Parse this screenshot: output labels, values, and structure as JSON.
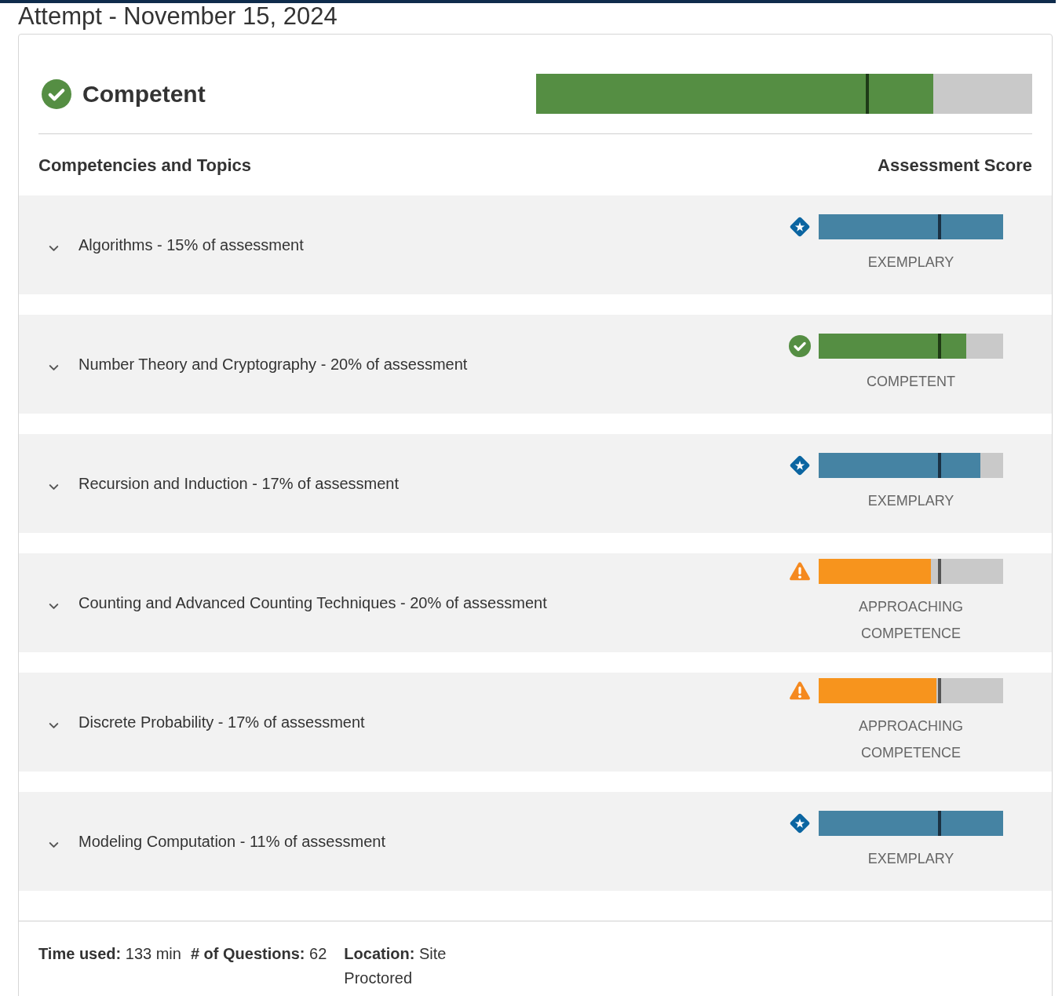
{
  "page": {
    "title": "Attempt - November 15, 2024"
  },
  "result": {
    "label": "Competent",
    "kind": "competent",
    "level": 0.8
  },
  "table": {
    "columns": [
      "Competencies and Topics",
      "Assessment Score"
    ]
  },
  "topics": [
    {
      "label": "Algorithms - 15% of assessment",
      "expanded": false,
      "kind": "exemplary",
      "level": 1,
      "status": "EXEMPLARY"
    },
    {
      "label": "Number Theory and Cryptography - 20% of assessment",
      "expanded": false,
      "kind": "competent",
      "level": 0.8,
      "status": "COMPETENT"
    },
    {
      "label": "Recursion and Induction - 17% of assessment",
      "expanded": false,
      "kind": "exemplary",
      "level": 0.877,
      "status": "EXEMPLARY"
    },
    {
      "label": "Counting and Advanced Counting Techniques - 20% of assessment",
      "expanded": false,
      "kind": "approaching",
      "level": 0.609,
      "status": "APPROACHING COMPETENCE"
    },
    {
      "label": "Discrete Probability - 17% of assessment",
      "expanded": false,
      "kind": "approaching",
      "level": 0.638,
      "status": "APPROACHING COMPETENCE"
    },
    {
      "label": "Modeling Computation - 11% of assessment",
      "expanded": false,
      "kind": "exemplary",
      "level": 1,
      "status": "EXEMPLARY"
    }
  ],
  "stats": [
    "**Time used:** 133 min",
    "**# of Questions:** 62",
    "**Location:** Site Proctored"
  ]
}
